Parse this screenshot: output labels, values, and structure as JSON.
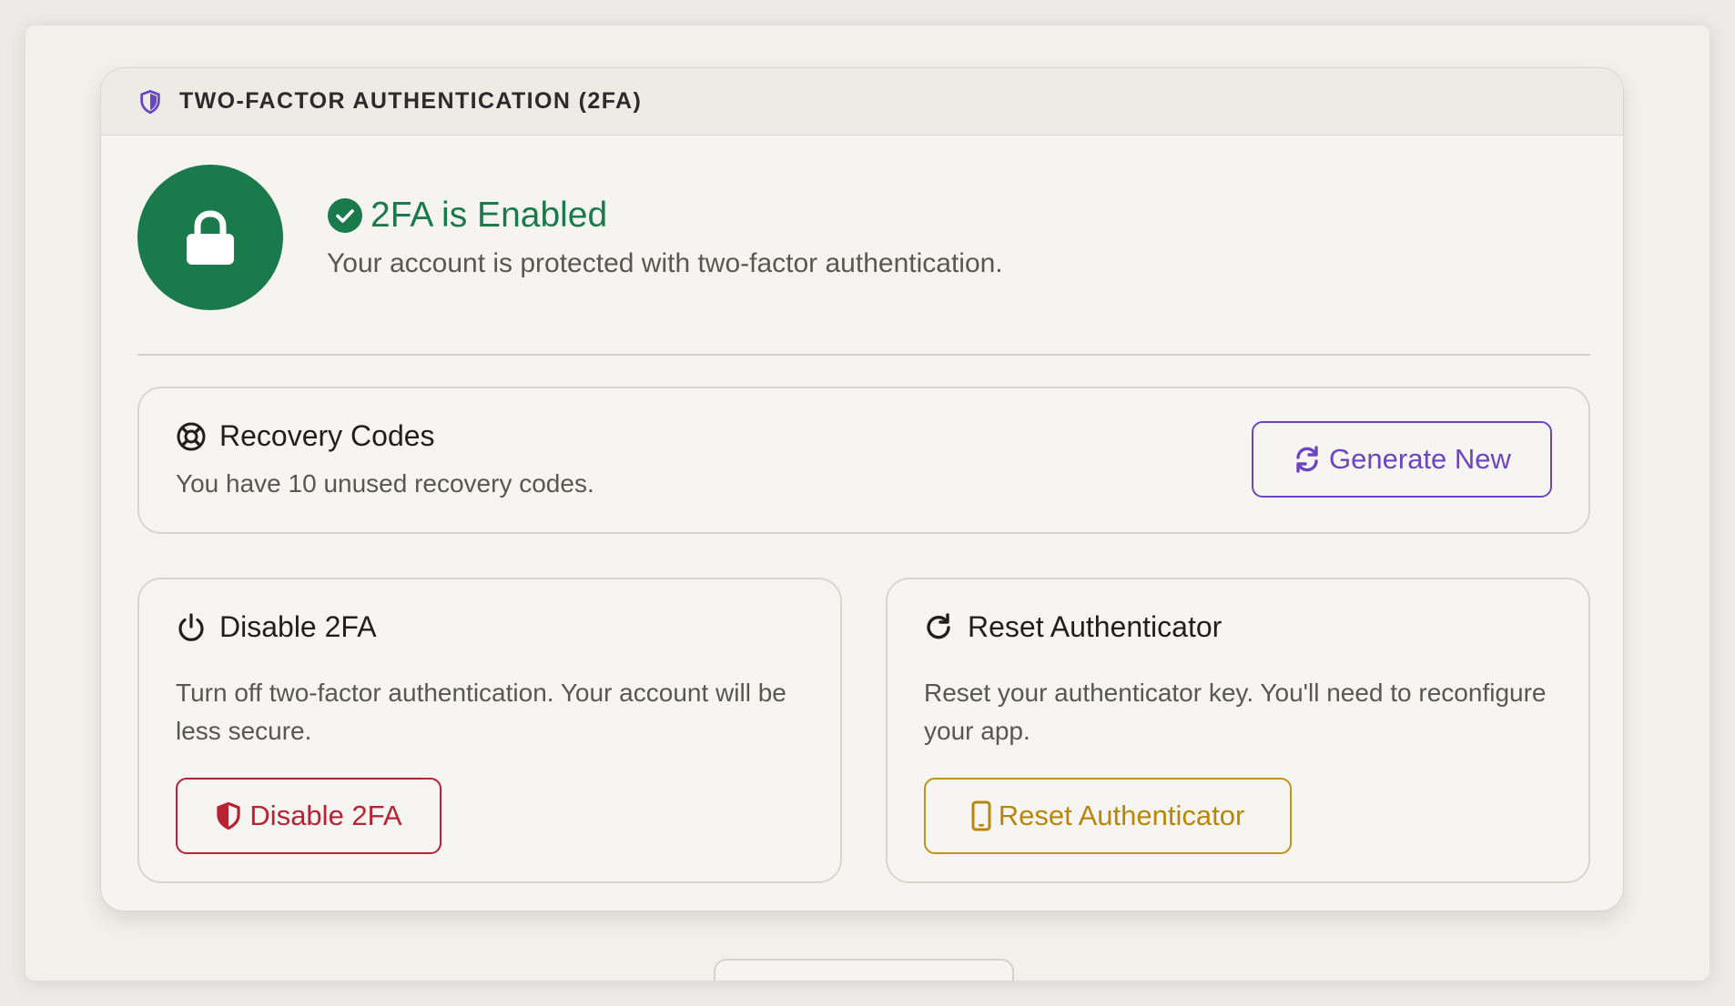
{
  "header": {
    "title": "TWO-FACTOR AUTHENTICATION (2FA)",
    "icon": "shield-icon"
  },
  "status": {
    "title": "2FA is Enabled",
    "description": "Your account is protected with two-factor authentication.",
    "icon": "lock-icon",
    "color": "#1b7a4b"
  },
  "recovery": {
    "title": "Recovery Codes",
    "description": "You have 10 unused recovery codes.",
    "button_label": "Generate New",
    "icon": "life-ring-icon",
    "button_icon": "refresh-icon",
    "accent": "#6b46c1"
  },
  "disable": {
    "title": "Disable 2FA",
    "description": "Turn off two-factor authentication. Your account will be less secure.",
    "button_label": "Disable 2FA",
    "icon": "power-icon",
    "button_icon": "shield-half-icon",
    "accent": "#b82233"
  },
  "reset": {
    "title": "Reset Authenticator",
    "description": "Reset your authenticator key. You'll need to reconfigure your app.",
    "button_label": "Reset Authenticator",
    "icon": "redo-icon",
    "button_icon": "mobile-icon",
    "accent": "#b8860b"
  }
}
